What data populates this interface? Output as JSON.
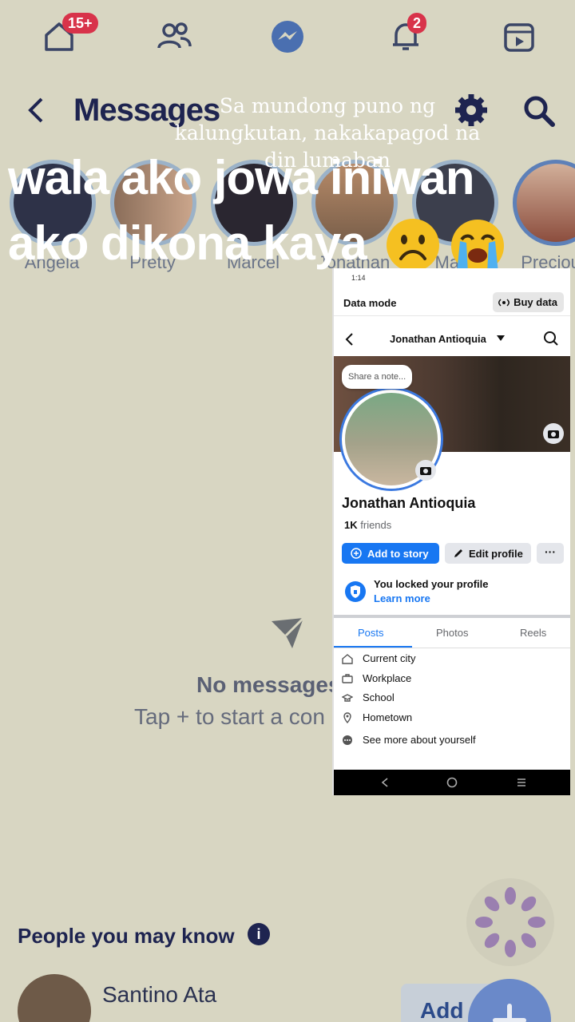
{
  "nav": {
    "home_badge": "15+",
    "notifications_badge": "2"
  },
  "header": {
    "title": "Messages"
  },
  "stories": [
    {
      "name": "Angela"
    },
    {
      "name": "Pretty"
    },
    {
      "name": "Marcel"
    },
    {
      "name": "Jonathan"
    },
    {
      "name": "Mark"
    },
    {
      "name": "Precious"
    }
  ],
  "overlay": {
    "serif_caption": "Sa mundong puno ng kalungkutan, nakakapagod na din lumaban",
    "line1": "wala ako jowa iniwan",
    "line2": "ako dikona kaya"
  },
  "empty": {
    "title": "No messages",
    "subtitle": "Tap + to start a con"
  },
  "people": {
    "heading": "People you may know",
    "info_glyph": "i",
    "first_name": "Santino Ata",
    "add_label": "Add"
  },
  "inset": {
    "status_time": "1:14",
    "data_mode": "Data mode",
    "buy_data": "Buy data",
    "header_name": "Jonathan Antioquia",
    "note_placeholder": "Share a note...",
    "full_name": "Jonathan Antioquia",
    "friends_count": "1K",
    "friends_label": "friends",
    "add_story": "Add to story",
    "edit_profile": "Edit profile",
    "more": "···",
    "locked_text": "You locked your profile",
    "learn_more": "Learn more",
    "tabs": [
      "Posts",
      "Photos",
      "Reels"
    ],
    "about": [
      "Current city",
      "Workplace",
      "School",
      "Hometown",
      "See more about yourself"
    ]
  },
  "colors": {
    "background": "#d8d6c2",
    "navy": "#1e2450",
    "fb_blue": "#1877f2",
    "badge_red": "#d8334a"
  }
}
